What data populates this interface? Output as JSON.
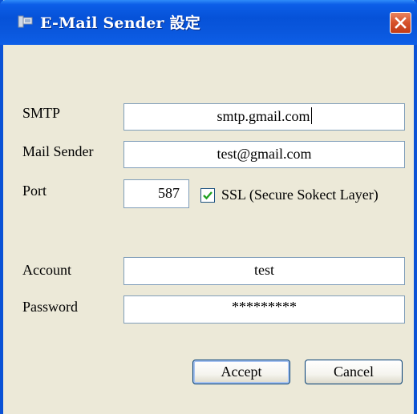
{
  "window": {
    "title": "E-Mail Sender 設定",
    "close_icon": "close-icon",
    "app_icon": "window-app-icon"
  },
  "form": {
    "smtp": {
      "label": "SMTP",
      "value": "smtp.gmail.com"
    },
    "mail_sender": {
      "label": "Mail Sender",
      "value": "test@gmail.com"
    },
    "port": {
      "label": "Port",
      "value": "587"
    },
    "ssl": {
      "label": "SSL (Secure Sokect Layer)",
      "checked": true
    },
    "account": {
      "label": "Account",
      "value": "test"
    },
    "password": {
      "label": "Password",
      "value": "*********"
    }
  },
  "buttons": {
    "accept": "Accept",
    "cancel": "Cancel"
  },
  "colors": {
    "titlebar": "#0a52d6",
    "dialog_bg": "#ece9d8",
    "close_button": "#d6512a",
    "checkmark": "#21a121"
  }
}
